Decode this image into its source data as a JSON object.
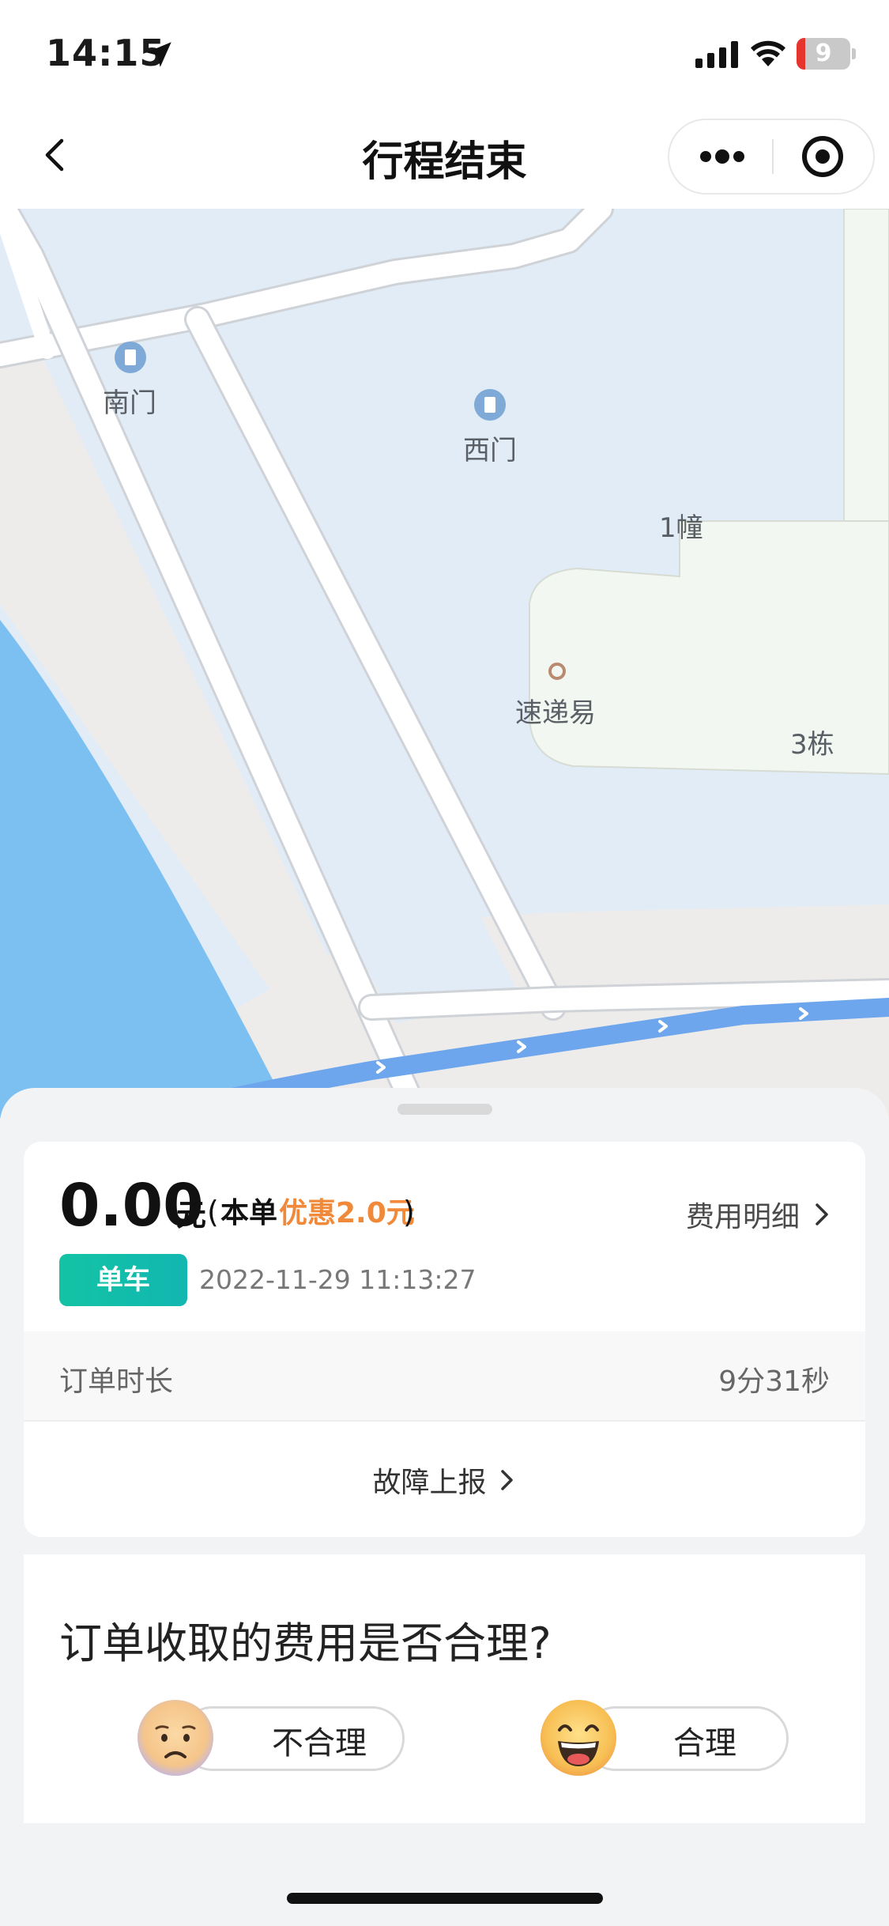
{
  "status_bar": {
    "time": "14:15",
    "battery_percent": "9",
    "battery_level": 0.09,
    "location_icon": "location-arrow-icon",
    "signal_icon": "cellular-signal-icon",
    "wifi_icon": "wifi-icon",
    "battery_icon": "battery-icon"
  },
  "nav": {
    "title": "行程结束",
    "back_icon": "chevron-left-icon",
    "more_icon": "more-dots-icon",
    "close_icon": "target-close-icon"
  },
  "map": {
    "labels": {
      "south_gate": "南门",
      "west_gate": "西门",
      "building_1": "1幢",
      "express": "速递易",
      "building_3": "3栋"
    },
    "route_color": "#6ea6ee",
    "water_color": "#7cc0f2"
  },
  "fee_card": {
    "amount": "0.00",
    "unit": "元",
    "paren_open": "(",
    "discount_prefix": "本单",
    "discount_amount": "优惠2.0元",
    "paren_close": ")",
    "detail_label": "费用明细",
    "vehicle_tag": "单车",
    "order_time": "2022-11-29 11:13:27",
    "duration_label": "订单时长",
    "duration_value": "9分31秒",
    "fault_label": "故障上报",
    "accent_color": "#f08a3a",
    "tag_color": "#13c3a4"
  },
  "survey": {
    "question": "订单收取的费用是否合理?",
    "option_unreasonable": "不合理",
    "option_reasonable": "合理",
    "sad_icon": "sad-face-icon",
    "happy_icon": "happy-face-icon"
  }
}
